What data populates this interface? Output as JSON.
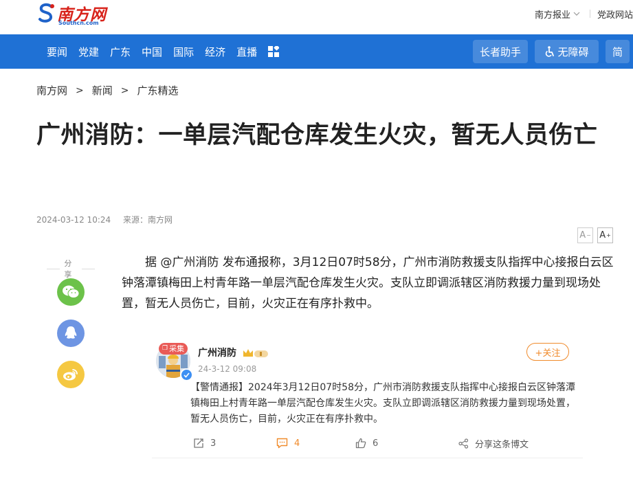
{
  "header": {
    "logo_cn": "南方网",
    "logo_en": "Southcn.com",
    "links": [
      "南方报业",
      "党政网站"
    ]
  },
  "nav": {
    "items": [
      "要闻",
      "党建",
      "广东",
      "中国",
      "国际",
      "经济",
      "直播"
    ],
    "elder_mode": "长者助手",
    "accessibility": "无障碍",
    "simplified": "简"
  },
  "breadcrumb": [
    "南方网",
    "新闻",
    "广东精选"
  ],
  "article": {
    "title": "广州消防：一单层汽配仓库发生火灾，暂无人员伤亡",
    "date": "2024-03-12 10:24",
    "source_label": "来源：",
    "source": "南方网",
    "font_small": "A",
    "font_large": "A",
    "body": "据 @广州消防 发布通报称，3月12日07时58分，广州市消防救援支队指挥中心接报白云区钟落潭镇梅田上村青年路一单层汽配仓库发生火灾。支队立即调派辖区消防救援力量到现场处置，暂无人员伤亡，目前，火灾正在有序扑救中。"
  },
  "share": {
    "label": "分享",
    "items": [
      "wechat-icon",
      "qq-icon",
      "weibo-icon"
    ]
  },
  "weibo": {
    "tag": "采集",
    "name": "广州消防",
    "time": "24-3-12 09:08",
    "follow": "+关注",
    "text": "【警情通报】2024年3月12日07时58分，广州市消防救援支队指挥中心接报白云区钟落潭镇梅田上村青年路一单层汽配仓库发生火灾。支队立即调派辖区消防救援力量到现场处置，暂无人员伤亡，目前，火灾正在有序扑救中。",
    "reposts": "3",
    "comments": "4",
    "likes": "6",
    "share_text": "分享这条博文"
  },
  "colors": {
    "nav_blue": "#1f71d5",
    "logo_red": "#d8231b",
    "follow_orange": "#f08a2a",
    "wechat_green": "#6cc24a",
    "qq_blue": "#6e95e3",
    "weibo_yellow": "#f5c842"
  }
}
